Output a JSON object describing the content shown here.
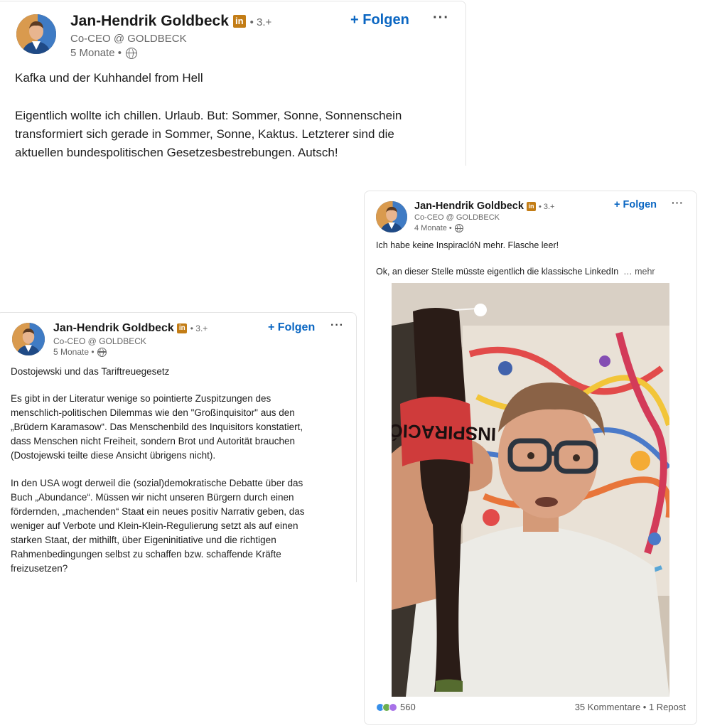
{
  "colors": {
    "follow": "#0a66c2",
    "badge": "#c37d16",
    "muted": "#666666"
  },
  "post1": {
    "author": "Jan-Hendrik Goldbeck",
    "badge": "in",
    "degree": "• 3.+",
    "headline": "Co-CEO @ GOLDBECK",
    "time": "5 Monate •",
    "follow": "+ Folgen",
    "more": "···",
    "title": "Kafka und der Kuhhandel from Hell",
    "body": "Eigentlich wollte ich chillen. Urlaub. But: Sommer, Sonne, Sonnenschein\ntransformiert sich gerade in Sommer, Sonne, Kaktus. Letzterer sind die\naktuellen bundespolitischen Gesetzesbestrebungen. Autsch!"
  },
  "post2": {
    "author": "Jan-Hendrik Goldbeck",
    "badge": "in",
    "degree": "• 3.+",
    "headline": "Co-CEO @ GOLDBECK",
    "time": "5 Monate •",
    "follow": "+ Folgen",
    "more": "···",
    "title": "Dostojewski und das Tariftreuegesetz",
    "para1": "Es gibt in der Literatur wenige so pointierte Zuspitzungen des\nmenschlich-politischen Dilemmas wie den \"Großinquisitor\" aus den\n„Brüdern Karamasow“. Das Menschenbild des Inquisitors konstatiert,\ndass Menschen nicht Freiheit, sondern Brot und Autorität brauchen\n(Dostojewski teilte diese Ansicht übrigens nicht).",
    "para2": "In den USA wogt derweil die (sozial)demokratische Debatte über das\nBuch „Abundance“. Müssen wir nicht unseren Bürgern durch einen\nfördernden, „machenden“ Staat ein neues positiv Narrativ geben, das\nweniger auf Verbote und Klein-Klein-Regulierung setzt als auf einen\nstarken Staat, der mithilft, über Eigeninitiative und die richtigen\nRahmenbedingungen selbst zu schaffen bzw. schaffende Kräfte\nfreizusetzen?"
  },
  "post3": {
    "author": "Jan-Hendrik Goldbeck",
    "badge": "in",
    "degree": "• 3.+",
    "headline": "Co-CEO @ GOLDBECK",
    "time": "4 Monate •",
    "follow": "+ Folgen",
    "more": "···",
    "line1": "Ich habe keine InspiraclóN mehr. Flasche leer!",
    "line2": "Ok, an dieser Stelle müsste eigentlich die klassische LinkedIn",
    "see_more": "… mehr",
    "bottle_label": "INSPIRACIÓN",
    "reaction_count": "560",
    "comments": "35 Kommentare • 1 Repost"
  }
}
